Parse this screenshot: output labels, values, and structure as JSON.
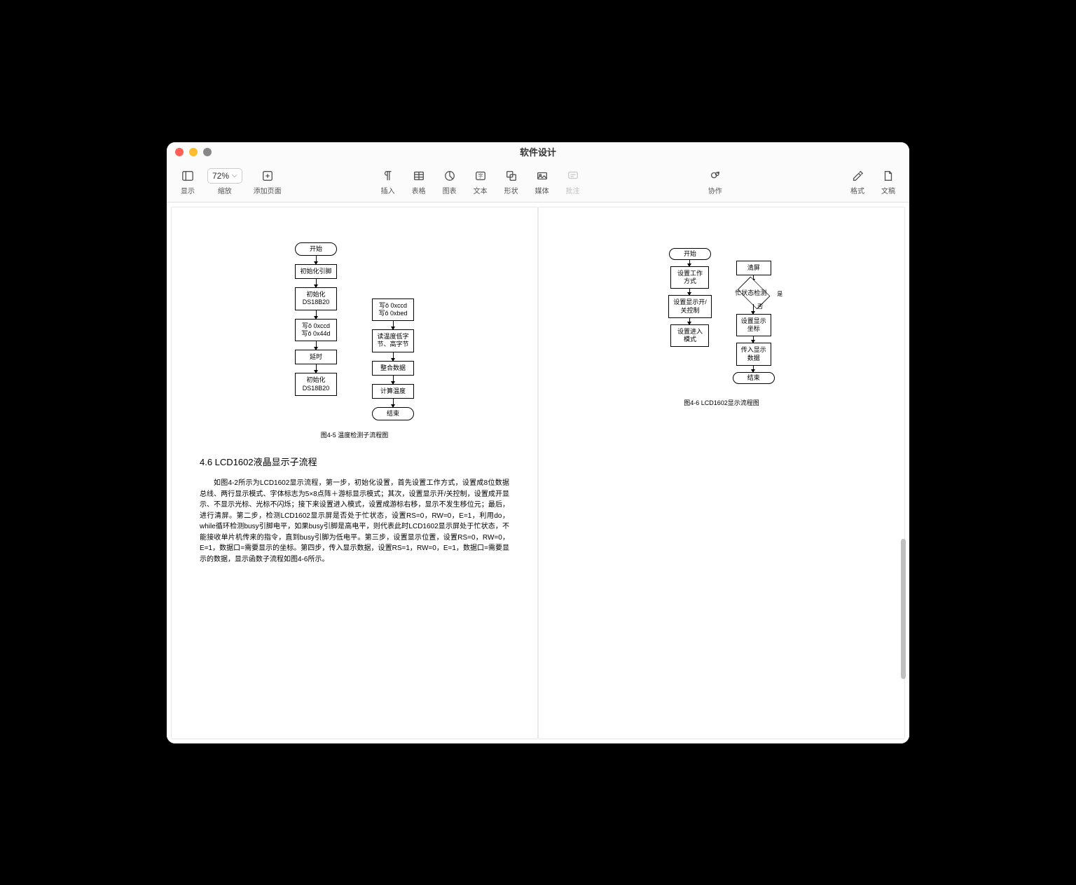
{
  "window": {
    "title": "软件设计"
  },
  "toolbar": {
    "view": "显示",
    "zoom_label": "缩放",
    "zoom_value": "72%",
    "add_page": "添加页面",
    "insert": "插入",
    "table": "表格",
    "chart": "图表",
    "text": "文本",
    "shape": "形状",
    "media": "媒体",
    "annotate": "批注",
    "collaborate": "协作",
    "format": "格式",
    "document": "文稿"
  },
  "page1": {
    "flow_left": {
      "start": "开始",
      "n1": "初始化引脚",
      "n2": "初始化\nDS18B20",
      "n3": "写ǒ 0xccd\n写ǒ 0x44d",
      "n4": "延时",
      "n5": "初始化\nDS18B20"
    },
    "flow_right": {
      "n1": "写ǒ 0xccd\n写ǒ 0xbed",
      "n2": "读温度低字\n节、高字节",
      "n3": "整合数据",
      "n4": "计算温度",
      "end": "结束"
    },
    "caption": "图4-5 温度检测子流程图",
    "heading": "4.6 LCD1602液晶显示子流程",
    "body": "如图4-2所示为LCD1602显示流程，第一步，初始化设置，首先设置工作方式，设置成8位数据总线、两行显示模式、字体标志为5×8点阵＋游标显示模式；其次，设置显示开/关控制，设置成开显示、不显示光标、光标不闪烁；接下来设置进入模式，设置成游标右移，显示不发生移位元；最后，进行清屏。第二步，检测LCD1602显示屏是否处于忙状态，设置RS=0，RW=0，E=1，利用do，while循环检测busy引脚电平，如果busy引脚是高电平，则代表此时LCD1602显示屏处于忙状态，不能接收单片机传来的指令，直到busy引脚为低电平。第三步，设置显示位置，设置RS=0，RW=0，E=1，数据口=需要显示的坐标。第四步，传入显示数据，设置RS=1，RW=0，E=1，数据口=需要显示的数据，显示函数子流程如图4-6所示。"
  },
  "page2": {
    "flow_left": {
      "start": "开始",
      "n1": "设置工作\n方式",
      "n2": "设置显示开/\n关控制",
      "n3": "设置进入\n模式"
    },
    "flow_right": {
      "n1": "清屏",
      "d1": "忙状态检测",
      "d1_yes": "是",
      "d1_no": "否",
      "n2": "设置显示\n坐标",
      "n3": "传入显示\n数据",
      "end": "结束"
    },
    "caption": "图4-6 LCD1602显示流程图"
  }
}
